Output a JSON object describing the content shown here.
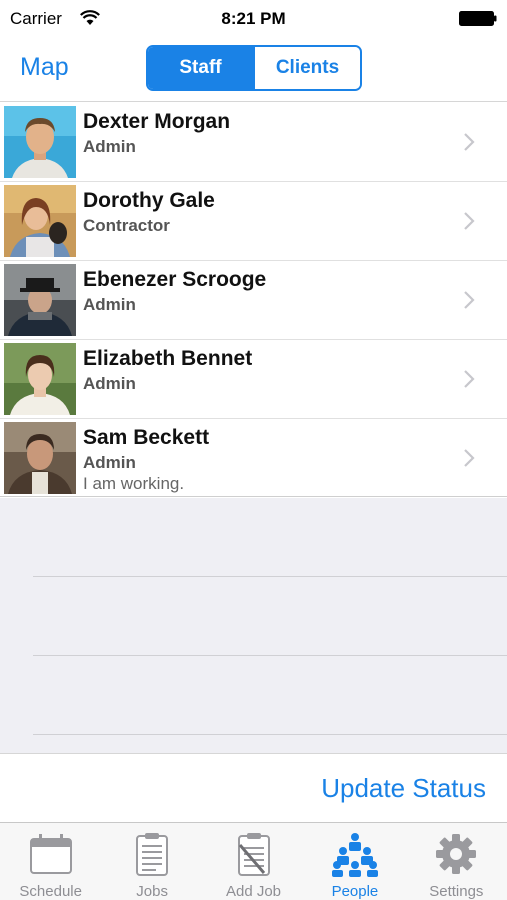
{
  "status_bar": {
    "carrier": "Carrier",
    "time": "8:21 PM"
  },
  "nav": {
    "left_button": "Map",
    "segments": [
      {
        "label": "Staff",
        "selected": true
      },
      {
        "label": "Clients",
        "selected": false
      }
    ]
  },
  "people": [
    {
      "name": "Dexter Morgan",
      "role": "Admin",
      "status": ""
    },
    {
      "name": "Dorothy Gale",
      "role": "Contractor",
      "status": ""
    },
    {
      "name": "Ebenezer Scrooge",
      "role": "Admin",
      "status": ""
    },
    {
      "name": "Elizabeth Bennet",
      "role": "Admin",
      "status": ""
    },
    {
      "name": "Sam Beckett",
      "role": "Admin",
      "status": "I am working."
    }
  ],
  "toolbar": {
    "update_status_label": "Update Status"
  },
  "tabs": [
    {
      "label": "Schedule",
      "icon": "calendar-icon",
      "active": false
    },
    {
      "label": "Jobs",
      "icon": "clipboard-icon",
      "active": false
    },
    {
      "label": "Add Job",
      "icon": "add-job-clipboard-icon",
      "active": false
    },
    {
      "label": "People",
      "icon": "people-icon",
      "active": true
    },
    {
      "label": "Settings",
      "icon": "gear-icon",
      "active": false
    }
  ],
  "colors": {
    "accent": "#1a82e6",
    "inactive_tab": "#8e8e93",
    "background_gray": "#efeff4"
  }
}
